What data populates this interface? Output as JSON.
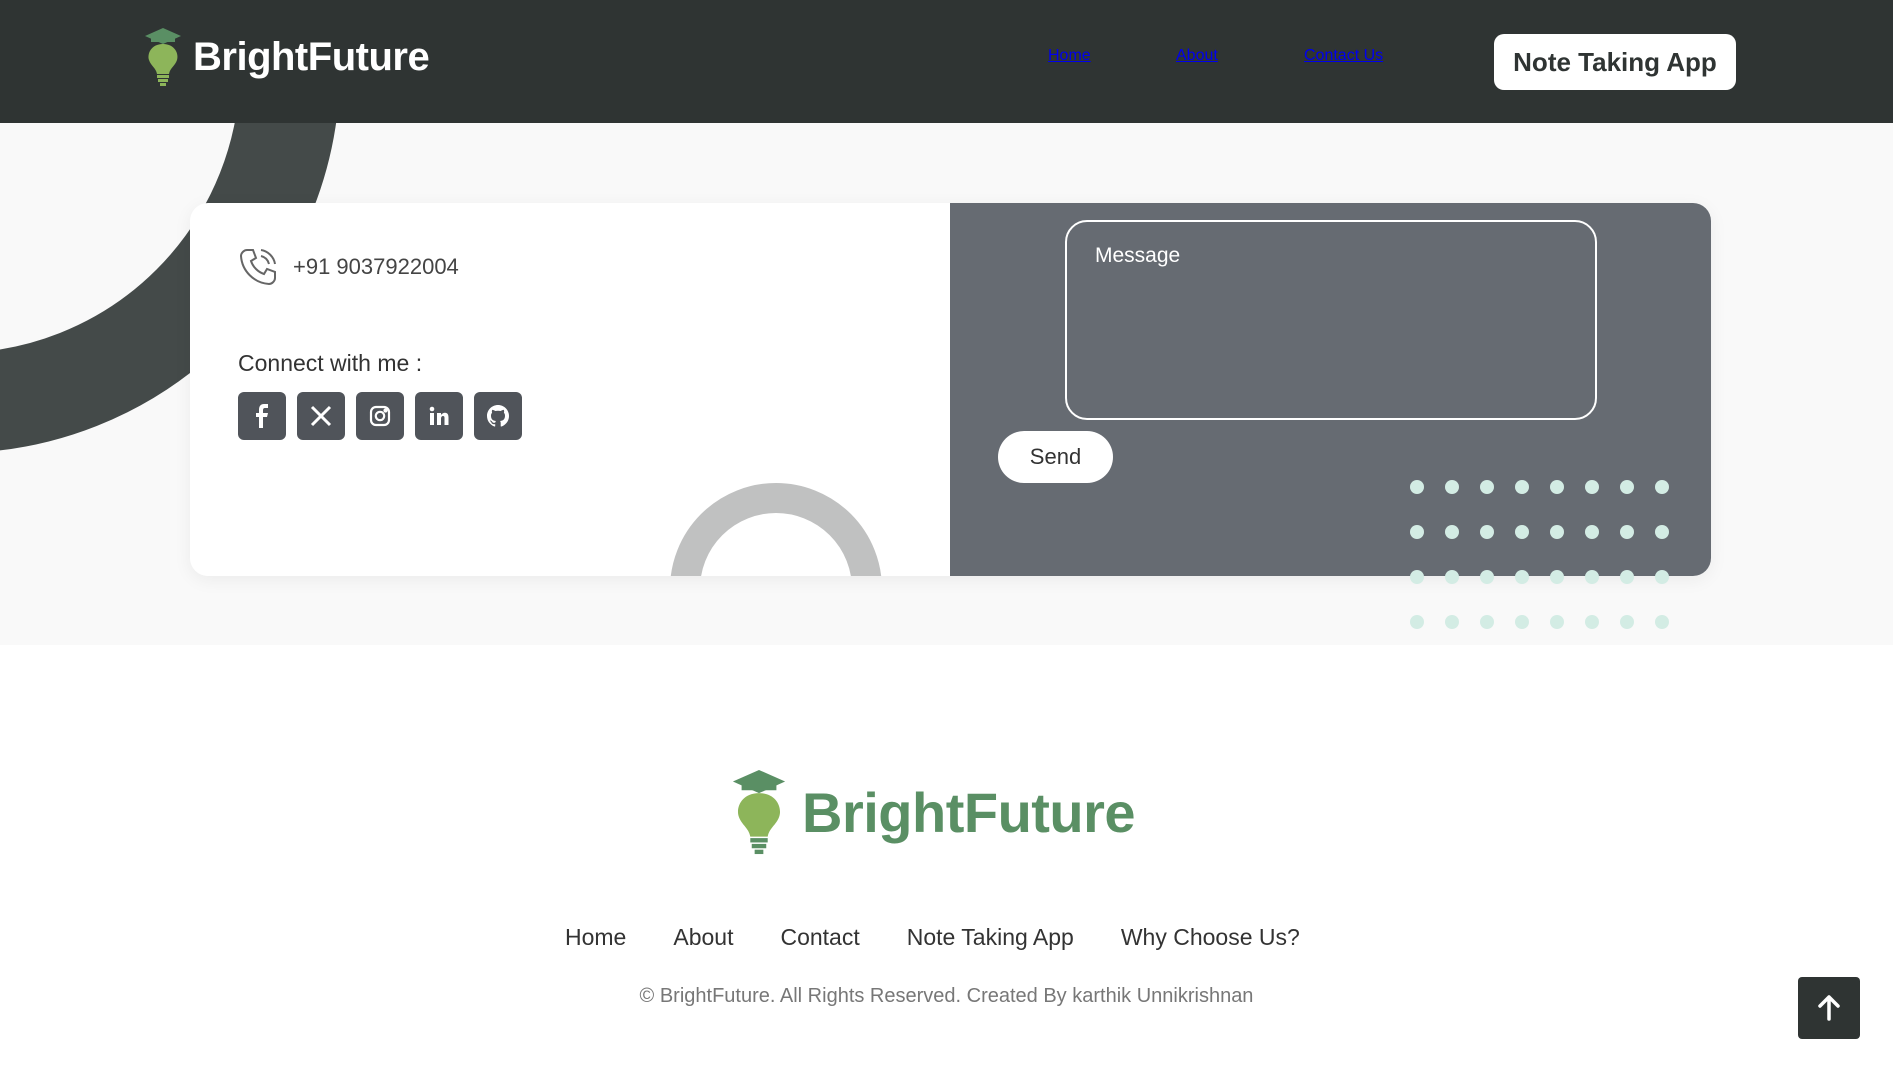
{
  "header": {
    "brand": "BrightFuture",
    "nav": [
      "Home",
      "About",
      "Contact Us"
    ],
    "cta": "Note Taking App"
  },
  "contact": {
    "phone": "+91 9037922004",
    "connect_label": "Connect with me :",
    "socials": [
      {
        "name": "facebook",
        "icon": "facebook-icon"
      },
      {
        "name": "x",
        "icon": "x-icon"
      },
      {
        "name": "instagram",
        "icon": "instagram-icon"
      },
      {
        "name": "linkedin",
        "icon": "linkedin-icon"
      },
      {
        "name": "github",
        "icon": "github-icon"
      }
    ],
    "message_placeholder": "Message",
    "send_label": "Send"
  },
  "footer": {
    "brand": "BrightFuture",
    "links": [
      "Home",
      "About",
      "Contact",
      "Note Taking App",
      "Why Choose Us?"
    ],
    "copyright": "© BrightFuture. All Rights Reserved. Created By karthik Unnikrishnan"
  },
  "colors": {
    "header_bg": "#2f3433",
    "card_right_bg": "#666b72",
    "brand_green": "#5a8f64",
    "bulb_green": "#8db55a",
    "dot_color": "#d3ece4"
  }
}
